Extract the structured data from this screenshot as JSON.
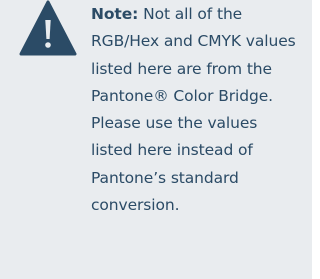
{
  "note": {
    "icon": "warning-triangle-icon",
    "label": "Note:",
    "body": "Not all of the RGB/Hex and CMYK values listed here are from the Pantone® Color Bridge. Please use the values listed here instead of Pantone’s standard conversion."
  },
  "colors": {
    "panel_background": "#e9ecef",
    "icon_fill": "#2b4b66",
    "icon_mark": "#e9ecef",
    "text": "#2b4b66"
  }
}
